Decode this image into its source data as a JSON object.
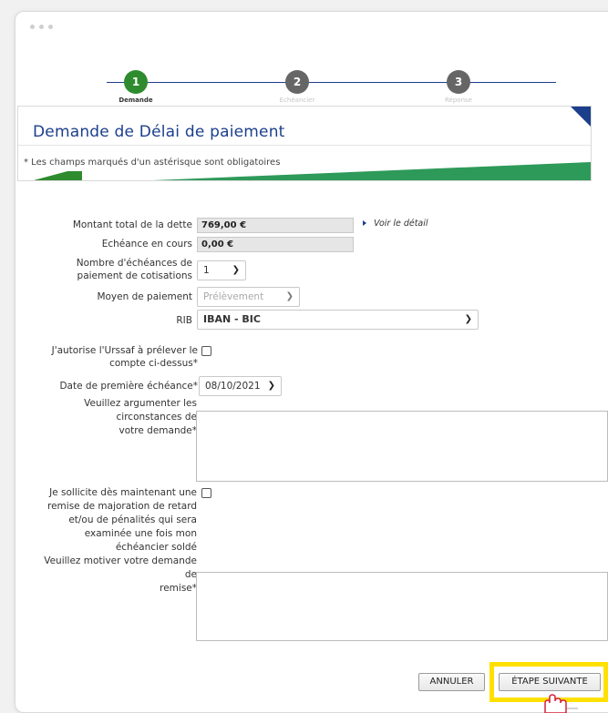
{
  "stepper": {
    "steps": [
      {
        "number": "1",
        "label": "Demande"
      },
      {
        "number": "2",
        "label": "Echéancier"
      },
      {
        "number": "3",
        "label": "Réponse"
      }
    ]
  },
  "header": {
    "title": "Demande de Délai de paiement",
    "required_note": "* Les champs marqués d'un astérisque sont obligatoires"
  },
  "form": {
    "total_debt_label": "Montant total de la dette",
    "total_debt_value": "769,00 €",
    "detail_link": "Voir le détail",
    "current_due_label": "Echéance en cours",
    "current_due_value": "0,00 €",
    "installments_label_1": "Nombre d'échéances de",
    "installments_label_2": "paiement de cotisations",
    "installments_value": "1",
    "payment_method_label": "Moyen de paiement",
    "payment_method_value": "Prélèvement",
    "rib_label": "RIB",
    "rib_value": "IBAN - BIC",
    "authorize_label_1": "J'autorise l'Urssaf à prélever le",
    "authorize_label_2": "compte ci-dessus*",
    "first_due_label": "Date de première échéance*",
    "first_due_value": "08/10/2021",
    "argue_label_1": "Veuillez argumenter les",
    "argue_label_2": "circonstances de",
    "argue_label_3": "votre demande*",
    "remission_label_1": "Je sollicite dès maintenant une",
    "remission_label_2": "remise de majoration de retard",
    "remission_label_3": "et/ou de pénalités qui sera",
    "remission_label_4": "examinée une fois mon",
    "remission_label_5": "échéancier soldé",
    "motivate_label_1": "Veuillez motiver votre demande",
    "motivate_label_2": "de",
    "motivate_label_3": "remise*"
  },
  "buttons": {
    "cancel": "ANNULER",
    "next": "ÉTAPE SUIVANTE"
  },
  "colors": {
    "primary_blue": "#1c3f8c",
    "active_green": "#2e8b2e",
    "highlight_yellow": "#ffe000"
  }
}
